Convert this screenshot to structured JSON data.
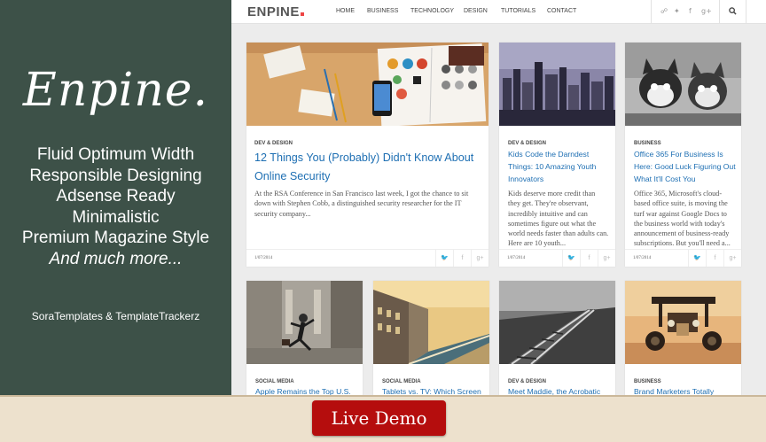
{
  "promo": {
    "logo": "Enpine.",
    "features": [
      "Fluid Optimum Width",
      "Responsible Designing",
      "Adsense Ready",
      "Minimalistic",
      "Premium Magazine Style"
    ],
    "more": "And much more...",
    "credit": "SoraTemplates & TemplateTrackerz",
    "bg_color": "#3d5148"
  },
  "site": {
    "brand": "ENPINE",
    "nav": [
      "HOME",
      "BUSINESS",
      "TECHNOLOGY",
      "DESIGN",
      "TUTORIALS",
      "CONTACT"
    ],
    "social_icons": [
      "rss-icon",
      "twitter-icon",
      "facebook-icon",
      "google-plus-icon"
    ],
    "search_icon": "search-icon"
  },
  "posts": [
    {
      "category": "DEV & DESIGN",
      "title": "12 Things You (Probably) Didn't Know About Online Security",
      "excerpt": "At the RSA Conference in San Francisco last week, I got the chance to sit down with Stephen Cobb, a distinguished security researcher for the IT security company...",
      "date": "1/07/2014"
    },
    {
      "category": "DEV & DESIGN",
      "title": "Kids Code the Darndest Things: 10 Amazing Youth Innovators",
      "excerpt": "Kids deserve more credit than they get. They're observant, incredibly intuitive and can sometimes figure out what the world needs faster than adults can. Here are 10 youth...",
      "date": "1/07/2014"
    },
    {
      "category": "BUSINESS",
      "title": "Office 365 For Business Is Here: Good Luck Figuring Out What It'll Cost You",
      "excerpt": "Office 365, Microsoft's cloud-based office suite, is moving the turf war against Google Docs to the business world with today's announcement of business-ready subscriptions. But you'll need a...",
      "date": "1/07/2014"
    },
    {
      "category": "SOCIAL MEDIA",
      "title": "Apple Remains the Top U.S."
    },
    {
      "category": "SOCIAL MEDIA",
      "title": "Tablets vs. TV: Which Screen"
    },
    {
      "category": "DEV & DESIGN",
      "title": "Meet Maddie, the Acrobatic"
    },
    {
      "category": "BUSINESS",
      "title": "Brand Marketers Totally"
    }
  ],
  "share": {
    "twitter": "🐦",
    "facebook": "f",
    "gplus": "g+"
  },
  "banner": {
    "button": "Live Demo",
    "button_color": "#b50d0d",
    "bg_color": "#ede1cd"
  }
}
